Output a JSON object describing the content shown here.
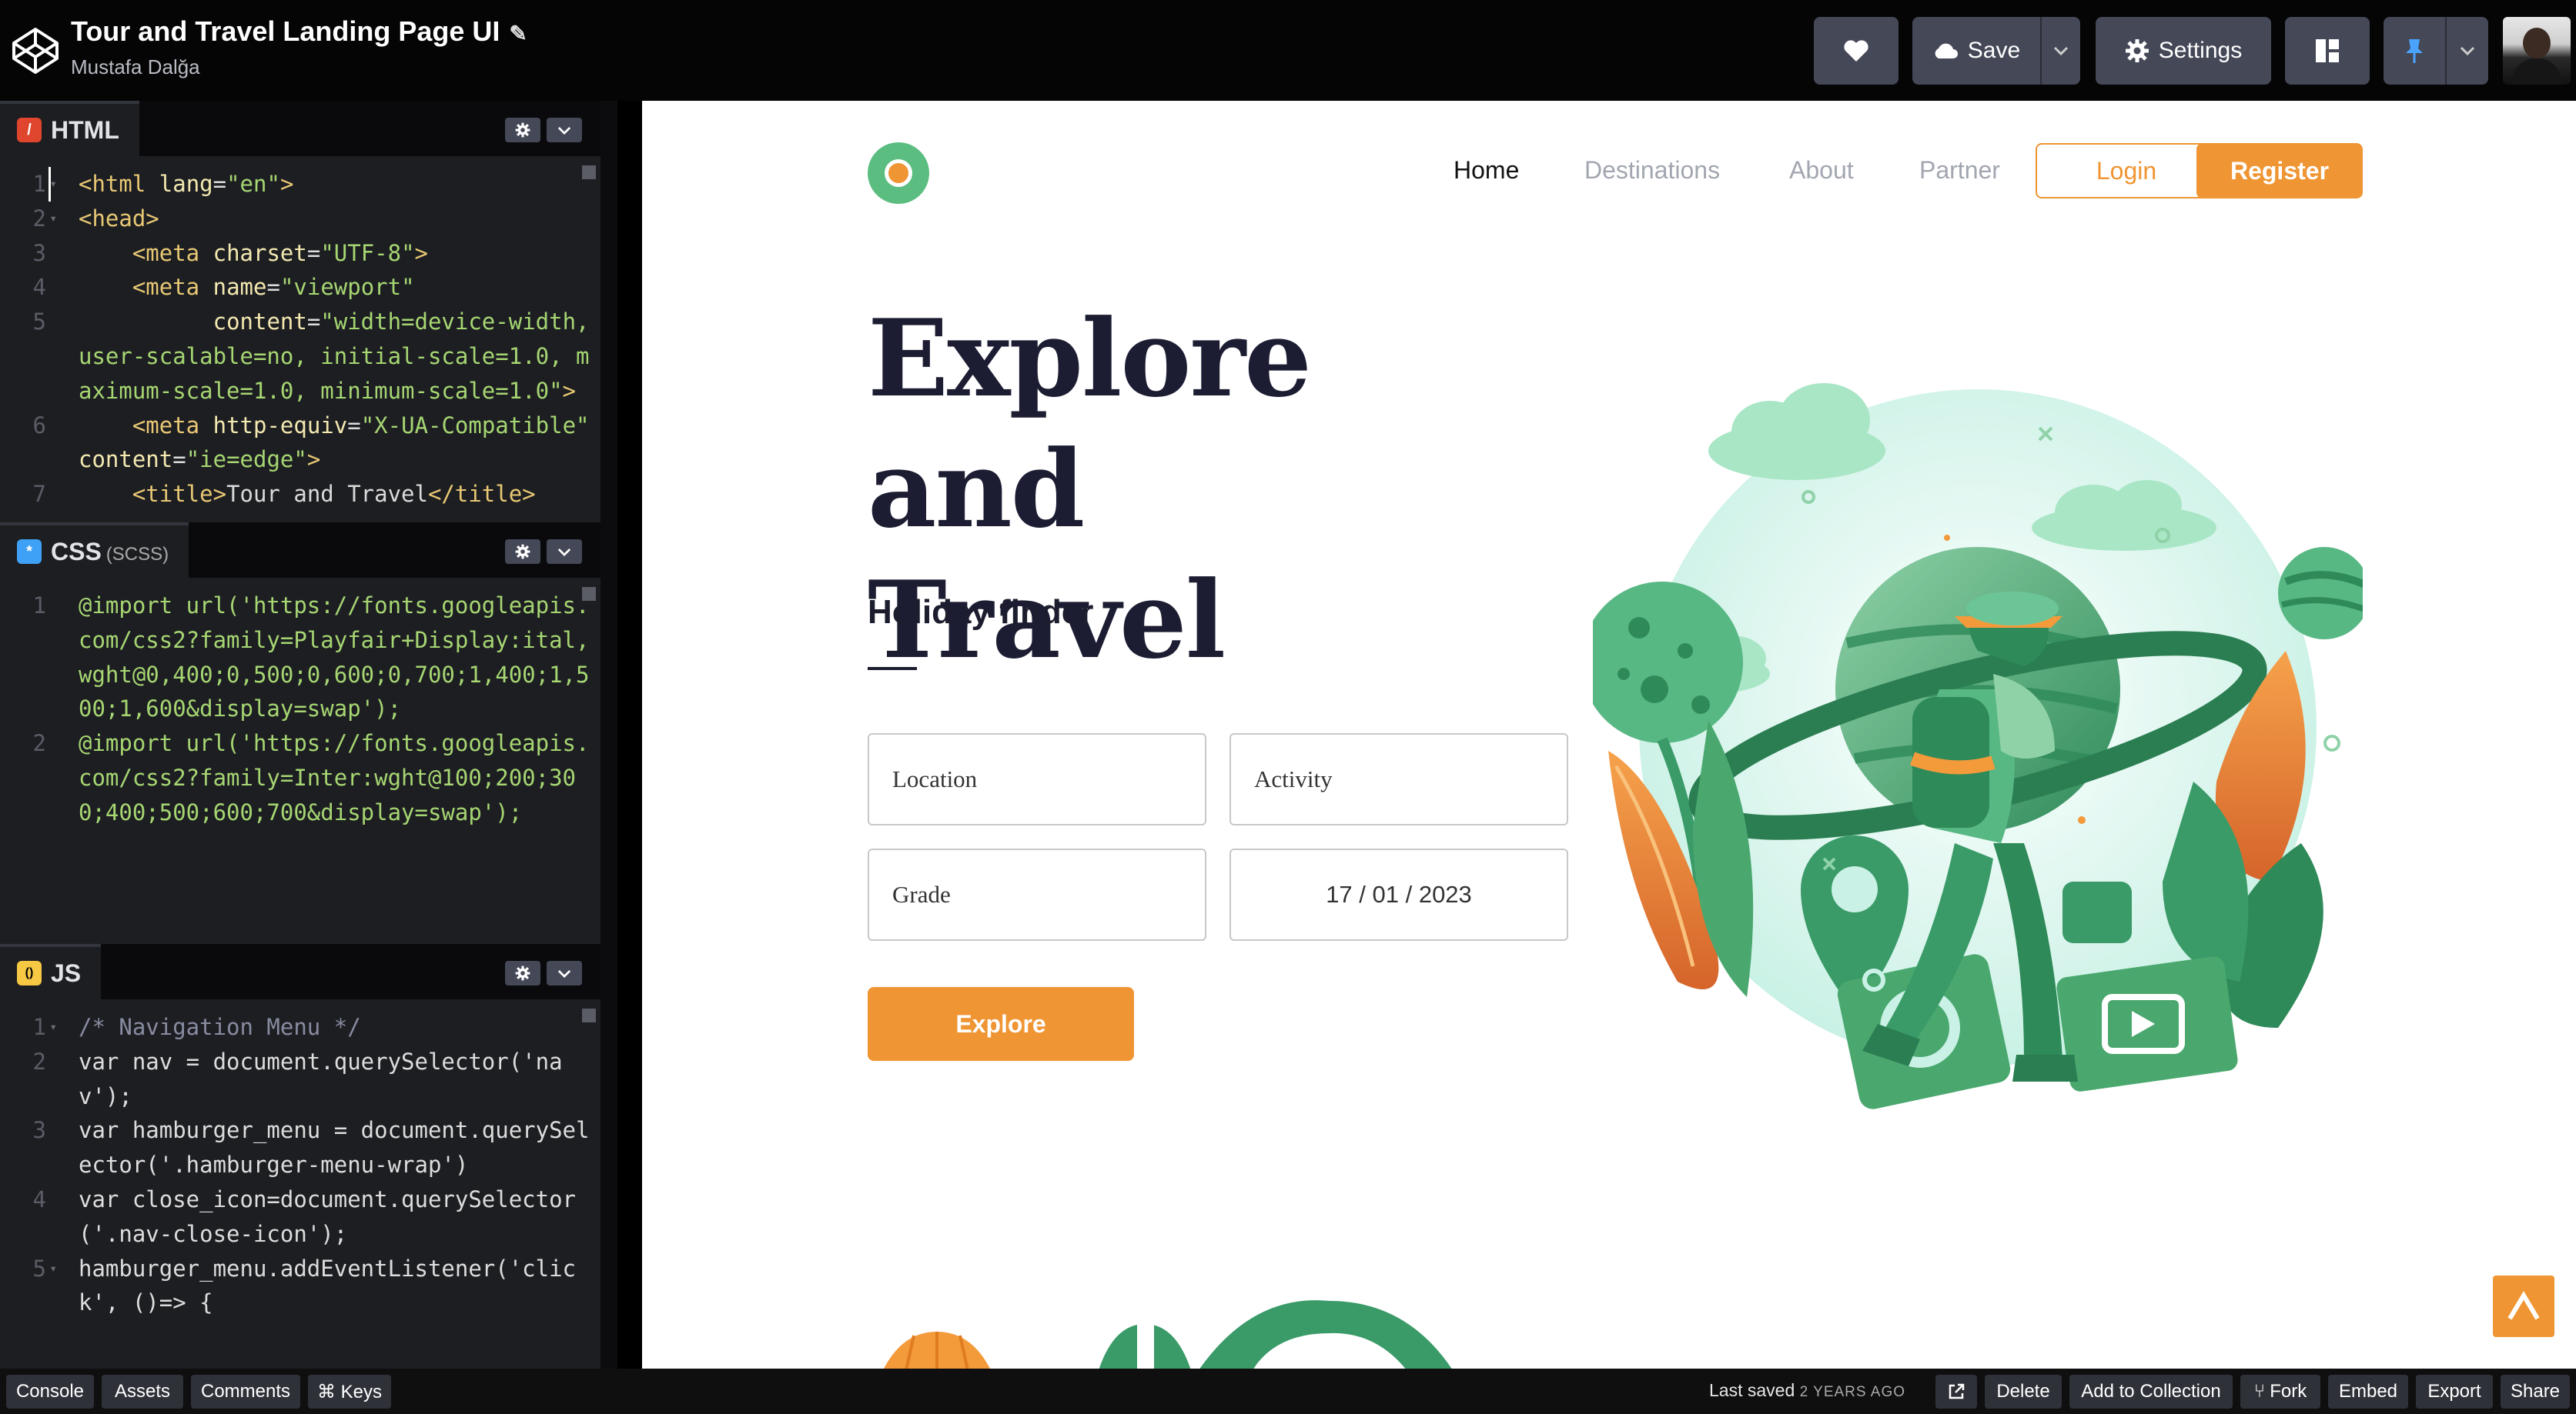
{
  "header": {
    "pen_title": "Tour and Travel Landing Page UI",
    "author": "Mustafa Dalğa",
    "save_label": "Save",
    "settings_label": "Settings"
  },
  "editors": {
    "html": {
      "name": "HTML",
      "badge": "/",
      "lines": [
        {
          "n": "1",
          "code": "<html lang=\"en\">"
        },
        {
          "n": "2",
          "code": "<head>"
        },
        {
          "n": "3",
          "code": "    <meta charset=\"UTF-8\">"
        },
        {
          "n": "4",
          "code": "    <meta name=\"viewport\""
        },
        {
          "n": "5",
          "code": "          content=\"width=device-width, user-scalable=no, initial-scale=1.0, maximum-scale=1.0, minimum-scale=1.0\">"
        },
        {
          "n": "6",
          "code": "    <meta http-equiv=\"X-UA-Compatible\" content=\"ie=edge\">"
        },
        {
          "n": "7",
          "code": "    <title>Tour and Travel</title>"
        }
      ]
    },
    "css": {
      "name": "CSS",
      "sub": "(SCSS)",
      "badge": "*",
      "lines": [
        {
          "n": "1",
          "code": "@import url('https://fonts.googleapis.com/css2?family=Playfair+Display:ital,wght@0,400;0,500;0,600;0,700;1,400;1,500;1,600&display=swap');"
        },
        {
          "n": "2",
          "code": "@import url('https://fonts.googleapis.com/css2?family=Inter:wght@100;200;300;400;500;600;700&display=swap');"
        }
      ]
    },
    "js": {
      "name": "JS",
      "badge": "()",
      "lines": [
        {
          "n": "1",
          "code": "/* Navigation Menu */"
        },
        {
          "n": "2",
          "code": "var nav = document.querySelector('nav');"
        },
        {
          "n": "3",
          "code": "var hamburger_menu = document.querySelector('.hamburger-menu-wrap')"
        },
        {
          "n": "4",
          "code": "var close_icon=document.querySelector('.nav-close-icon');"
        },
        {
          "n": "5",
          "code": "hamburger_menu.addEventListener('click', ()=> {"
        }
      ]
    }
  },
  "preview": {
    "nav": {
      "home": "Home",
      "destinations": "Destinations",
      "about": "About",
      "partner": "Partner",
      "login": "Login",
      "register": "Register"
    },
    "hero": {
      "title_line1": "Explore and",
      "title_line2": "Travel",
      "subtitle": "Holiday finder"
    },
    "form": {
      "location": "Location",
      "activity": "Activity",
      "grade": "Grade",
      "date": "17 / 01 / 2023",
      "explore": "Explore"
    },
    "colors": {
      "accent": "#ef9533",
      "green": "#5bbd80",
      "dark_text": "#1c1d33"
    }
  },
  "footer": {
    "console": "Console",
    "assets": "Assets",
    "comments": "Comments",
    "keys": "⌘ Keys",
    "last_saved": "Last saved",
    "last_saved_ago": "2 YEARS AGO",
    "delete": "Delete",
    "add_to_collection": "Add to Collection",
    "fork": "Fork",
    "embed": "Embed",
    "export": "Export",
    "share": "Share"
  }
}
